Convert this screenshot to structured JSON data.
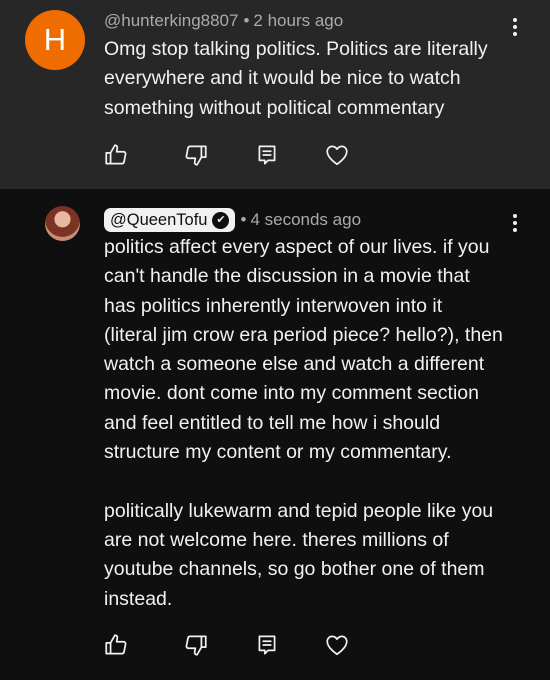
{
  "comments": [
    {
      "avatar_letter": "H",
      "avatar_color": "#ef6c00",
      "author": "@hunterking8807",
      "separator": "•",
      "time": "2 hours ago",
      "text": "Omg stop talking politics. Politics are literally\neverywhere and it would be nice to watch\nsomething without political commentary",
      "background": "#272727"
    },
    {
      "author": "@QueenTofu",
      "verified_mark": "✔",
      "separator": "•",
      "time": "4 seconds ago",
      "text": "politics affect every aspect of our lives. if you\ncan't handle the discussion in a movie that\nhas politics inherently interwoven into it\n(literal jim crow era period piece? hello?), then\nwatch a someone else and watch a different\nmovie. dont come into my comment section\nand feel entitled to tell me how i should\nstructure my content or my commentary.\n\npolitically lukewarm and tepid people like you\nare not welcome here. theres millions of\nyoutube channels, so go bother one of them\ninstead.",
      "background": "#0f0f0f"
    }
  ],
  "icons": [
    "thumbs-up-icon",
    "thumbs-down-icon",
    "reply-icon",
    "heart-icon",
    "more-vert-icon",
    "verified-icon"
  ]
}
